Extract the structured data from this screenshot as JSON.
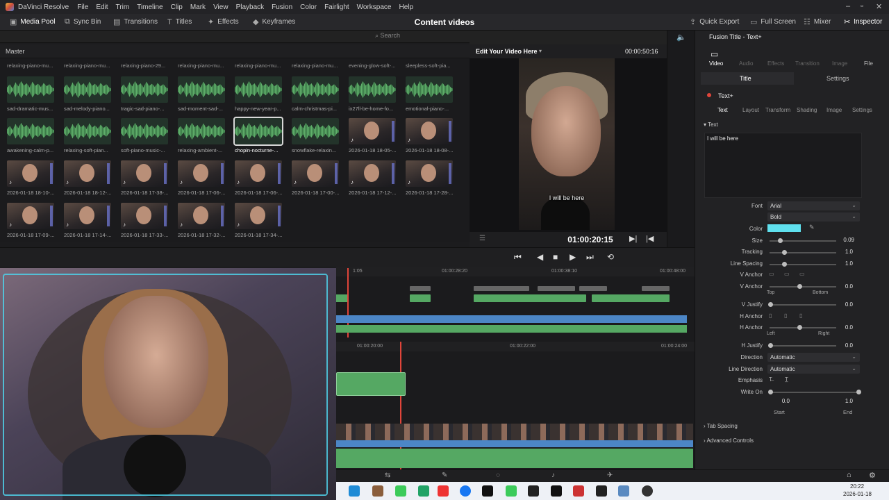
{
  "menubar": {
    "app_name": "DaVinci Resolve",
    "items": [
      "File",
      "Edit",
      "Trim",
      "Timeline",
      "Clip",
      "Mark",
      "View",
      "Playback",
      "Fusion",
      "Color",
      "Fairlight",
      "Workspace",
      "Help"
    ]
  },
  "toolbar": {
    "left": [
      "Media Pool",
      "Sync Bin",
      "Transitions",
      "Titles",
      "Effects",
      "Keyframes"
    ],
    "project_title": "Content videos",
    "right": [
      "Quick Export",
      "Full Screen",
      "Mixer",
      "Inspector"
    ]
  },
  "media_pool": {
    "search_placeholder": "Search",
    "bin_name": "Master",
    "top_row_labels": [
      "relaxing-piano-mu...",
      "relaxing-piano-mu...",
      "relaxing-piano-29...",
      "relaxing-piano-mu...",
      "relaxing-piano-mu...",
      "relaxing-piano-mu...",
      "evening-glow-soft-...",
      "sleepless-soft-pia..."
    ],
    "rows": [
      [
        {
          "name": "sad-dramatic-mus...",
          "type": "audio"
        },
        {
          "name": "sad-melody-piano...",
          "type": "audio"
        },
        {
          "name": "tragic-sad-piano-...",
          "type": "audio"
        },
        {
          "name": "sad-moment-sad-...",
          "type": "audio"
        },
        {
          "name": "happy-new-year-p...",
          "type": "audio"
        },
        {
          "name": "calm-christmas-pi...",
          "type": "audio"
        },
        {
          "name": "ix27ll-be-home-fo...",
          "type": "audio"
        },
        {
          "name": "emotional-piano-...",
          "type": "audio"
        }
      ],
      [
        {
          "name": "awakening-calm-p...",
          "type": "audio"
        },
        {
          "name": "relaxing-soft-pian...",
          "type": "audio"
        },
        {
          "name": "soft-piano-music-...",
          "type": "audio"
        },
        {
          "name": "relaxing-ambient-...",
          "type": "audio"
        },
        {
          "name": "chopin-nocturne-...",
          "type": "audio",
          "selected": true
        },
        {
          "name": "snowflake-relaxin...",
          "type": "audio"
        },
        {
          "name": "2026-01-18 18-05-...",
          "type": "video"
        },
        {
          "name": "2026-01-18 18-08-...",
          "type": "video"
        }
      ],
      [
        {
          "name": "2026-01-18 18-10-...",
          "type": "video"
        },
        {
          "name": "2026-01-18 18-12-...",
          "type": "video"
        },
        {
          "name": "2026-01-18 17-38-...",
          "type": "video"
        },
        {
          "name": "2026-01-18 17-06-...",
          "type": "video"
        },
        {
          "name": "2026-01-18 17-06-...",
          "type": "video"
        },
        {
          "name": "2026-01-18 17-00-...",
          "type": "video"
        },
        {
          "name": "2026-01-18 17-12-...",
          "type": "video"
        },
        {
          "name": "2026-01-18 17-28-...",
          "type": "video"
        }
      ],
      [
        {
          "name": "2026-01-18 17-09-...",
          "type": "video"
        },
        {
          "name": "2026-01-18 17-14-...",
          "type": "video"
        },
        {
          "name": "2026-01-18 17-33-...",
          "type": "video"
        },
        {
          "name": "2026-01-18 17-32-...",
          "type": "video"
        },
        {
          "name": "2026-01-18 17-34-...",
          "type": "video"
        }
      ]
    ]
  },
  "viewer": {
    "title": "Edit Your Video Here",
    "duration": "00:00:50:16",
    "subtitle": "I will be here",
    "timecode": "01:00:20:15"
  },
  "timeline": {
    "ruler_top": [
      "01:00:28:20",
      "01:00:38:10",
      "01:00:48:00"
    ],
    "ruler_top_partial": "1:05",
    "ruler_bottom": [
      "01:00:20:00",
      "01:00:22:00",
      "01:00:24:00"
    ]
  },
  "inspector": {
    "header": "Fusion Title - Text+",
    "tabs": [
      "Video",
      "Audio",
      "Effects",
      "Transition",
      "Image",
      "File"
    ],
    "subtabs": [
      "Title",
      "Settings"
    ],
    "tool_name": "Text+",
    "tool_tabs": [
      "Text",
      "Layout",
      "Transform",
      "Shading",
      "Image",
      "Settings"
    ],
    "section": "Text",
    "text_value": "I will be here",
    "font_label": "Font",
    "font": "Arial",
    "style": "Bold",
    "color_label": "Color",
    "color": "#5fe0ee",
    "size_label": "Size",
    "size": "0.09",
    "tracking_label": "Tracking",
    "tracking": "1.0",
    "line_spacing_label": "Line Spacing",
    "line_spacing": "1.0",
    "v_anchor_label": "V Anchor",
    "v_anchor_value": "0.0",
    "v_anchor_min": "Top",
    "v_anchor_max": "Bottom",
    "v_justify_label": "V Justify",
    "v_justify": "0.0",
    "h_anchor_label": "H Anchor",
    "h_anchor_value": "0.0",
    "h_anchor_min": "Left",
    "h_anchor_max": "Right",
    "h_justify_label": "H Justify",
    "h_justify": "0.0",
    "direction_label": "Direction",
    "direction": "Automatic",
    "line_direction_label": "Line Direction",
    "line_direction": "Automatic",
    "emphasis_label": "Emphasis",
    "write_on_label": "Write On",
    "write_on_start": "0.0",
    "write_on_end": "1.0",
    "start_label": "Start",
    "end_label": "End",
    "tab_spacing": "Tab Spacing",
    "advanced_controls": "Advanced Controls"
  },
  "taskbar": {
    "time": "20:22",
    "date": "2026-01-18"
  },
  "colors": {
    "accent_green": "#55a863",
    "accent_blue": "#4c86c6",
    "playhead": "#e0453a",
    "inspector_text_color": "#5fe0ee"
  }
}
